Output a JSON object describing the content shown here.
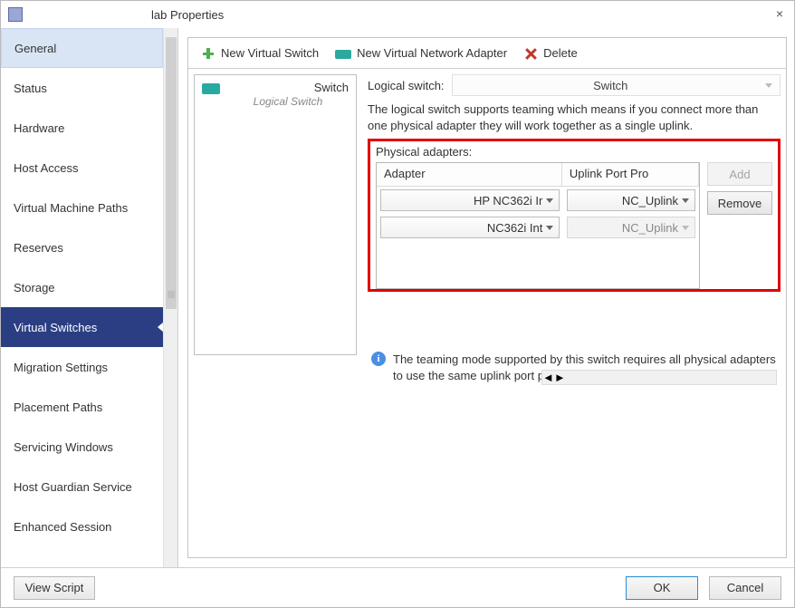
{
  "window": {
    "title": "lab Properties",
    "close_label": "×"
  },
  "sidebar": {
    "items": [
      {
        "label": "General"
      },
      {
        "label": "Status"
      },
      {
        "label": "Hardware"
      },
      {
        "label": "Host Access"
      },
      {
        "label": "Virtual Machine Paths"
      },
      {
        "label": "Reserves"
      },
      {
        "label": "Storage"
      },
      {
        "label": "Virtual Switches"
      },
      {
        "label": "Migration Settings"
      },
      {
        "label": "Placement Paths"
      },
      {
        "label": "Servicing Windows"
      },
      {
        "label": "Host Guardian Service"
      },
      {
        "label": "Enhanced Session"
      }
    ]
  },
  "toolbar": {
    "new_switch": "New Virtual Switch",
    "new_adapter": "New Virtual Network Adapter",
    "delete": "Delete"
  },
  "switch_list": {
    "name": "Switch",
    "subtitle": "Logical Switch"
  },
  "logical_switch": {
    "label": "Logical switch:",
    "selected": "Switch",
    "description": "The logical switch supports teaming which means if you connect more than one physical adapter they will work together as a single uplink."
  },
  "adapters": {
    "section_label": "Physical adapters:",
    "headers": {
      "adapter": "Adapter",
      "uplink": "Uplink Port Pro"
    },
    "rows": [
      {
        "adapter": "HP NC362i Ir",
        "uplink": "NC_Uplink"
      },
      {
        "adapter": "NC362i Int",
        "uplink": "NC_Uplink"
      }
    ],
    "add_btn": "Add",
    "remove_btn": "Remove"
  },
  "info": {
    "text": "The teaming mode supported by this switch requires all physical adapters to use the same uplink port profile."
  },
  "footer": {
    "view_script": "View Script",
    "ok": "OK",
    "cancel": "Cancel"
  }
}
